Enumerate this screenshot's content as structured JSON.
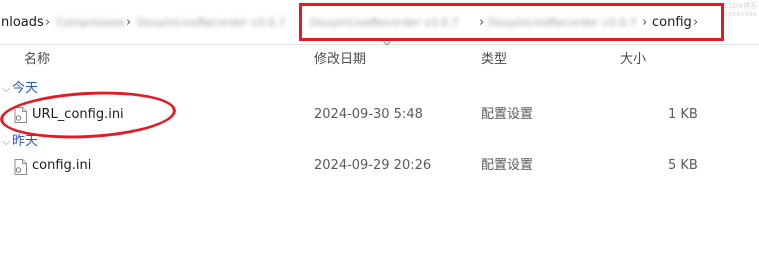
{
  "address_bar": {
    "crumbs": [
      {
        "label": "nloads",
        "blurred": false
      },
      {
        "label": "Compressed",
        "blurred": true
      },
      {
        "label": "DouyinLiveRecorder v3.0.7",
        "blurred": true
      },
      {
        "label": "DouyinLiveRecorder v3.0.7",
        "blurred": true
      },
      {
        "label": "DouyinLiveRecorder v3.0.7",
        "blurred": true
      },
      {
        "label": "config",
        "blurred": false
      }
    ],
    "separator": "›"
  },
  "columns": {
    "name": "名称",
    "modified": "修改日期",
    "type": "类型",
    "size": "大小"
  },
  "groups": [
    {
      "label": "今天",
      "files": [
        {
          "name": "URL_config.ini",
          "modified": "2024-09-30 5:48",
          "type": "配置设置",
          "size": "1 KB"
        }
      ]
    },
    {
      "label": "昨天",
      "files": [
        {
          "name": "config.ini",
          "modified": "2024-09-29 20:26",
          "type": "配置设置",
          "size": "5 KB"
        }
      ]
    }
  ],
  "annotations": {
    "highlight_color": "#e01b24"
  },
  "watermark": [
    "CSDN博客",
    "xxxxxxxx"
  ]
}
